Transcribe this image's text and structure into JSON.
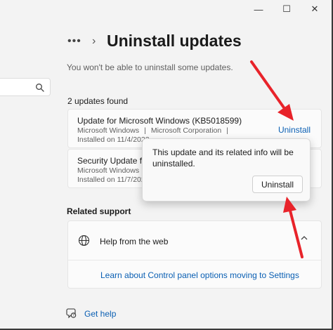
{
  "window_controls": {
    "minimize": "—",
    "maximize": "☐",
    "close": "✕"
  },
  "breadcrumb": {
    "more": "•••",
    "chevron": "›"
  },
  "page": {
    "title": "Uninstall updates",
    "subtitle": "You won't be able to uninstall some updates."
  },
  "updates": {
    "count_label": "2 updates found",
    "items": [
      {
        "name": "Update for Microsoft Windows (KB5018599)",
        "vendor": "Microsoft Windows",
        "sep1": "|",
        "publisher": "Microsoft Corporation",
        "sep2": "|",
        "installed": "Installed on 11/4/2022",
        "action": "Uninstall"
      },
      {
        "name": "Security Update for",
        "vendor": "Microsoft Windows",
        "sep1": "|",
        "installed": "Installed on 11/7/2022"
      }
    ]
  },
  "confirm_dialog": {
    "message": "This update and its related info will be uninstalled.",
    "button_label": "Uninstall"
  },
  "related_support": {
    "title": "Related support",
    "help_web": "Help from the web",
    "learn_link": "Learn about Control panel options moving to Settings"
  },
  "get_help": "Get help",
  "colors": {
    "background": "#f3f3f3",
    "card": "#fbfbfb",
    "link": "#0a5fb3",
    "annotation_arrow": "#e8232a"
  },
  "icons": {
    "search": "search-icon",
    "globe": "globe-icon",
    "chevron_up": "chevron-up-icon",
    "get_help": "get-help-icon"
  }
}
